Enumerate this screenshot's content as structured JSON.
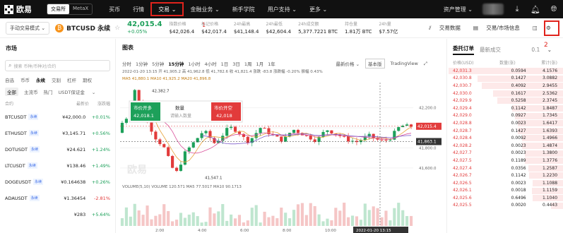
{
  "nav": {
    "logo": "欧易",
    "account_modes": [
      "交易所",
      "MetaX"
    ],
    "items": [
      "买币",
      "行情",
      "交易",
      "金融业务",
      "新手学院",
      "用户支持",
      "更多"
    ],
    "right_items": [
      "资产管理"
    ],
    "annotation1": "1"
  },
  "ticker": {
    "mode": "手动交易模式",
    "symbol": "BTCUSD 永续",
    "price": "42,015.4",
    "change": "+0.05%",
    "stats": [
      {
        "label": "指数价格",
        "value": "$42,026.4"
      },
      {
        "label": "标记价格",
        "value": "$42,017.4"
      },
      {
        "label": "24h最高",
        "value": "$41,148.4"
      },
      {
        "label": "24h最低",
        "value": "$42,604.4"
      },
      {
        "label": "24h成交额",
        "value": "5,377.7221 BTC"
      },
      {
        "label": "持仓量",
        "value": "1.81万 BTC"
      },
      {
        "label": "24h量",
        "value": "$7.57亿"
      }
    ],
    "right_links": [
      "交易数据",
      "交易/市场信息"
    ],
    "annotation2": "2"
  },
  "markets": {
    "title": "市场",
    "search_placeholder": "搜索 币种/币种对/合约",
    "tabs1": [
      "自选",
      "币币",
      "永续",
      "交割",
      "杠杆",
      "期权"
    ],
    "tabs2": [
      "全部",
      "主流币",
      "热门",
      "USDT保证金"
    ],
    "head": [
      "合约",
      "最新价",
      "涨跌幅"
    ],
    "rows": [
      {
        "name": "BTCUSDT",
        "tag": "永续",
        "price": "¥42,000.0",
        "change": "+0.01%",
        "dir": "up"
      },
      {
        "name": "ETHUSDT",
        "tag": "永续",
        "price": "¥3,145.71",
        "change": "+0.56%",
        "dir": "up"
      },
      {
        "name": "DOTUSDT",
        "tag": "永续",
        "price": "¥24.621",
        "change": "+1.24%",
        "dir": "up"
      },
      {
        "name": "LTCUSDT",
        "tag": "永续",
        "price": "¥138.46",
        "change": "+1.49%",
        "dir": "up"
      },
      {
        "name": "DOGEUSDT",
        "tag": "永续",
        "price": "¥0.164638",
        "change": "+0.26%",
        "dir": "up"
      },
      {
        "name": "ADAUSDT",
        "tag": "永续",
        "price": "¥1.36454",
        "change": "-2.81%",
        "dir": "dn"
      },
      {
        "name": "",
        "tag": "",
        "price": "¥283",
        "change": "+5.64%",
        "dir": "up"
      }
    ]
  },
  "chart": {
    "title": "图表",
    "timeframes": [
      "分时",
      "1分钟",
      "5分钟",
      "15分钟",
      "1小时",
      "4小时",
      "1日",
      "3日",
      "1周",
      "1月",
      "1年"
    ],
    "active_tf": "15分钟",
    "right_tools": [
      "最新价格",
      "基本版",
      "TradingView"
    ],
    "info_line": "2022-01-20 13:15  开 41,905.2  高 41,962.8  低 41,782.6  收 41,821.4  涨跌 -83.8  涨跌幅 -0.20%  振幅 0.43%",
    "ma_line": "MA5 41,880.1  MA10 41,925.2  MA20 41,896.8",
    "ma_colors": [
      "#e7a33c",
      "#d9509a",
      "#7d5ac9"
    ],
    "price_tag": "42,015.4",
    "cross_label": "41,863.1",
    "high_label": "42,382.7",
    "low_label": "41,547.1",
    "axis_labels": [
      "42,200.0",
      "42,000.0",
      "41,800.0",
      "41,600.0"
    ],
    "time_labels": [
      "2:00",
      "4:00",
      "6:00",
      "8:00",
      "10:00",
      "12:00"
    ],
    "time_cursor": "2022-01-20 13:15",
    "volume_line": "VOLUME(5,10)  VOLUME  120.571  MA5  77.5017  MA10  90.1713",
    "popup": {
      "open_long_title": "市价开多",
      "open_long_price": "42,018.1",
      "amount_label": "数量",
      "amount_placeholder": "请输入数量",
      "open_short_title": "市价开空",
      "open_short_price": "42,018"
    },
    "watermark": "欧易"
  },
  "orderbook": {
    "tabs": [
      "委托订单",
      "最新成交"
    ],
    "depth_step": "0.1",
    "head": [
      "价格(USD)",
      "数量(张)",
      "累计(张)"
    ],
    "rows": [
      [
        "42,031.3",
        "0.0594",
        "4.1576"
      ],
      [
        "42,030.8",
        "0.1427",
        "3.0882"
      ],
      [
        "42,030.7",
        "0.4092",
        "2.9455"
      ],
      [
        "42,030.0",
        "0.1617",
        "2.5362"
      ],
      [
        "42,029.9",
        "0.5258",
        "2.3745"
      ],
      [
        "42,029.4",
        "0.1142",
        "1.8487"
      ],
      [
        "42,029.0",
        "0.0927",
        "1.7345"
      ],
      [
        "42,028.8",
        "0.0023",
        "1.6417"
      ],
      [
        "42,028.7",
        "0.1427",
        "1.6393"
      ],
      [
        "42,028.4",
        "0.0092",
        "1.4966"
      ],
      [
        "42,028.2",
        "0.0023",
        "1.4874"
      ],
      [
        "42,027.7",
        "0.0023",
        "1.3800"
      ],
      [
        "42,027.5",
        "0.1189",
        "1.3776"
      ],
      [
        "42,027.4",
        "0.0356",
        "1.2587"
      ],
      [
        "42,026.7",
        "0.1142",
        "1.2230"
      ],
      [
        "42,026.5",
        "0.0023",
        "1.1088"
      ],
      [
        "42,026.1",
        "0.0018",
        "1.1159"
      ],
      [
        "42,025.6",
        "0.6496",
        "1.1040"
      ],
      [
        "42,025.5",
        "0.0020",
        "0.4443"
      ]
    ]
  }
}
